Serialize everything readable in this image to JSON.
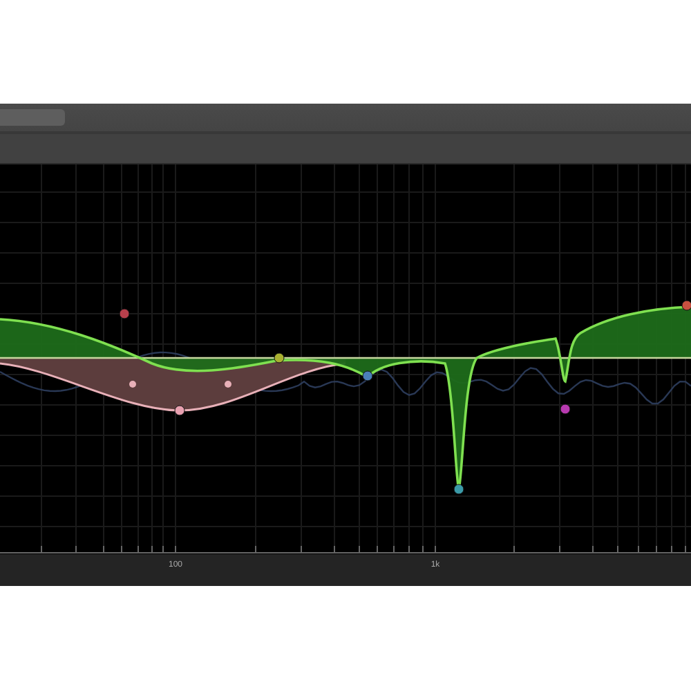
{
  "graph": {
    "bands": [
      {
        "color": "#b8404c"
      },
      {
        "color": "#e8a0b0"
      },
      {
        "color": "#a8b030"
      },
      {
        "color": "#4a7fb8"
      },
      {
        "color": "#3a9aa8"
      },
      {
        "color": "#b83ab0"
      },
      {
        "color": "#c85040"
      }
    ],
    "axis_labels": [
      "100",
      "1k"
    ]
  }
}
